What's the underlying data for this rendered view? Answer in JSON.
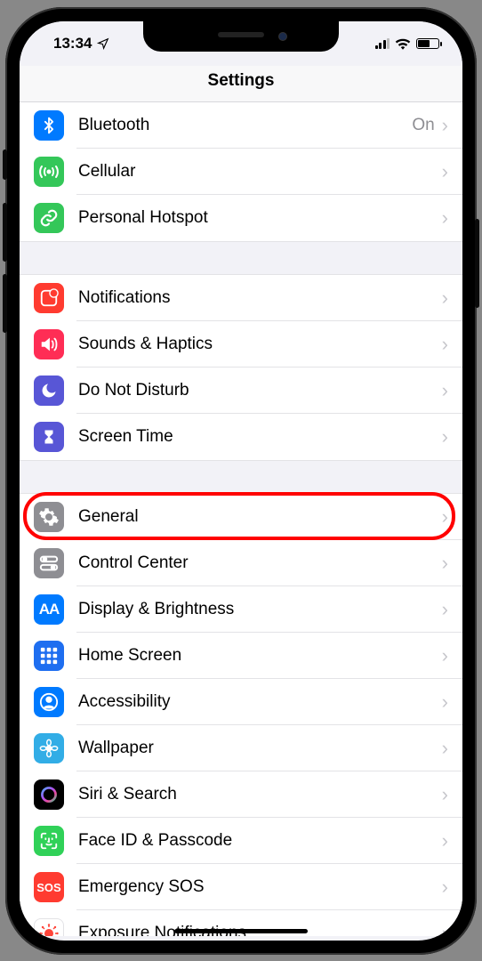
{
  "status": {
    "time": "13:34",
    "location_icon": "location-arrow"
  },
  "header": {
    "title": "Settings"
  },
  "highlight_row": "general",
  "groups": [
    {
      "id": "connectivity",
      "rows": [
        {
          "id": "bluetooth",
          "label": "Bluetooth",
          "icon": "bluetooth-icon",
          "color": "bg-blue",
          "value": "On"
        },
        {
          "id": "cellular",
          "label": "Cellular",
          "icon": "antenna-icon",
          "color": "bg-green"
        },
        {
          "id": "hotspot",
          "label": "Personal Hotspot",
          "icon": "link-icon",
          "color": "bg-green"
        }
      ]
    },
    {
      "id": "alerts",
      "rows": [
        {
          "id": "notifications",
          "label": "Notifications",
          "icon": "notification-icon",
          "color": "bg-red"
        },
        {
          "id": "sounds",
          "label": "Sounds & Haptics",
          "icon": "speaker-icon",
          "color": "bg-pink"
        },
        {
          "id": "dnd",
          "label": "Do Not Disturb",
          "icon": "moon-icon",
          "color": "bg-purple"
        },
        {
          "id": "screentime",
          "label": "Screen Time",
          "icon": "hourglass-icon",
          "color": "bg-purple"
        }
      ]
    },
    {
      "id": "main",
      "rows": [
        {
          "id": "general",
          "label": "General",
          "icon": "gear-icon",
          "color": "bg-grey"
        },
        {
          "id": "controlcenter",
          "label": "Control Center",
          "icon": "switches-icon",
          "color": "bg-grey"
        },
        {
          "id": "display",
          "label": "Display & Brightness",
          "icon": "text-size-icon",
          "color": "bg-blue"
        },
        {
          "id": "homescreen",
          "label": "Home Screen",
          "icon": "grid-icon",
          "color": "bg-darkblue"
        },
        {
          "id": "accessibility",
          "label": "Accessibility",
          "icon": "person-icon",
          "color": "bg-blue"
        },
        {
          "id": "wallpaper",
          "label": "Wallpaper",
          "icon": "flower-icon",
          "color": "bg-cyan"
        },
        {
          "id": "siri",
          "label": "Siri & Search",
          "icon": "siri-icon",
          "color": "bg-black"
        },
        {
          "id": "faceid",
          "label": "Face ID & Passcode",
          "icon": "faceid-icon",
          "color": "bg-green2"
        },
        {
          "id": "sos",
          "label": "Emergency SOS",
          "icon": "sos-icon",
          "color": "bg-red"
        },
        {
          "id": "exposure",
          "label": "Exposure Notifications",
          "icon": "virus-icon",
          "color": "bg-white"
        }
      ]
    }
  ]
}
